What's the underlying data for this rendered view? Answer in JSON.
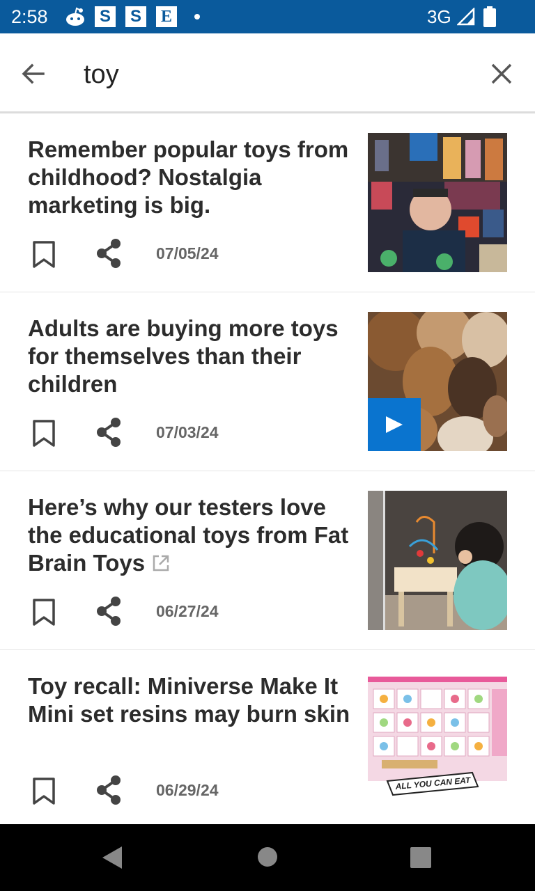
{
  "status_bar": {
    "time": "2:58",
    "network": "3G",
    "icons": [
      "reddit-icon",
      "s-app-icon",
      "s-app-icon",
      "e-app-icon",
      "notification-dot-icon",
      "signal-icon",
      "battery-icon"
    ],
    "app_letters": [
      "S",
      "S",
      "E"
    ]
  },
  "search": {
    "query": "toy"
  },
  "articles": [
    {
      "title": "Remember popular toys from childhood? Nostalgia marketing is big.",
      "date": "07/05/24",
      "has_video": false,
      "external": false
    },
    {
      "title": "Adults are buying more toys for themselves than their children",
      "date": "07/03/24",
      "has_video": true,
      "external": false
    },
    {
      "title": "Here’s why our testers love the educational toys from Fat Brain Toys",
      "date": "06/27/24",
      "has_video": false,
      "external": true
    },
    {
      "title": "Toy recall: Miniverse Make It Mini set resins may burn skin",
      "date": "06/29/24",
      "has_video": false,
      "external": false
    }
  ],
  "thumbnail_caption": "ALL YOU CAN EAT",
  "colors": {
    "status_bar": "#0a5a9c",
    "accent": "#0a74cf",
    "title_text": "#2c2c2c",
    "meta_text": "#666666"
  }
}
